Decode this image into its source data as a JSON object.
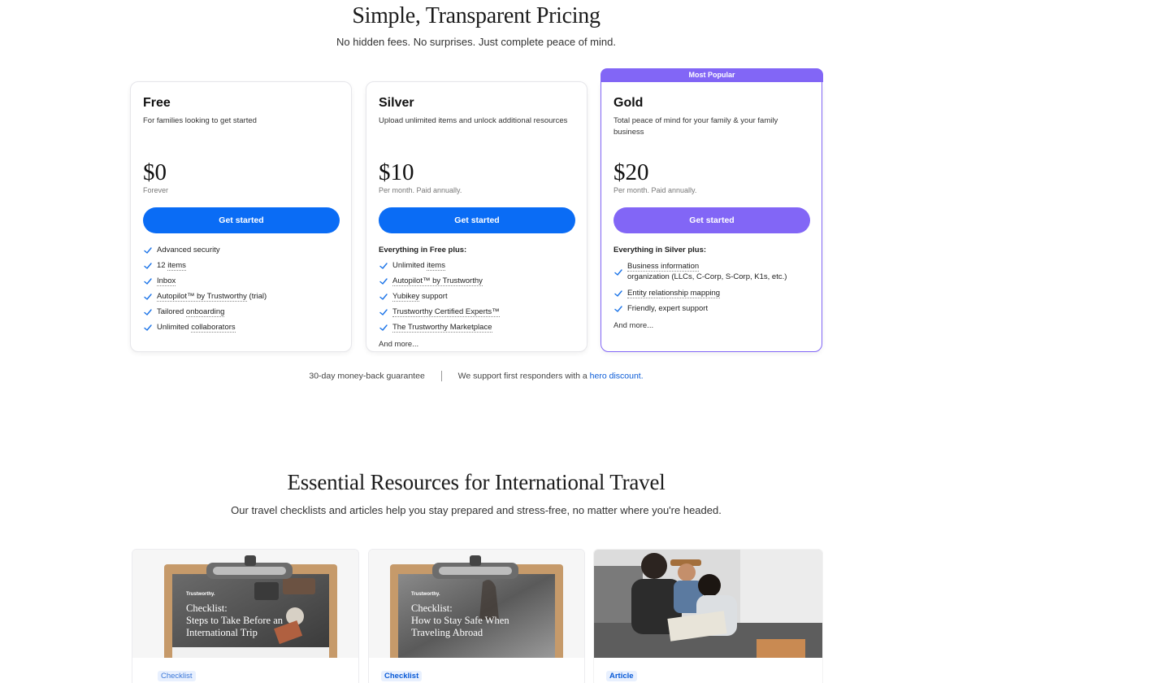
{
  "pricing": {
    "title": "Simple, Transparent Pricing",
    "subtitle": "No hidden fees. No surprises. Just complete peace of mind.",
    "popular_badge": "Most Popular",
    "plans": [
      {
        "name": "Free",
        "description": "For families looking to get started",
        "price": "$0",
        "price_note": "Forever",
        "button": "Get started",
        "features_heading": "",
        "features": [
          {
            "pre": "Advanced security",
            "link": "",
            "post": ""
          },
          {
            "pre": "12 ",
            "link": "items",
            "post": ""
          },
          {
            "pre": "",
            "link": "Inbox",
            "post": ""
          },
          {
            "pre": "",
            "link": "Autopilot™ by Trustworthy",
            "post": " (trial)"
          },
          {
            "pre": "Tailored ",
            "link": "onboarding",
            "post": ""
          },
          {
            "pre": "Unlimited ",
            "link": "collaborators",
            "post": ""
          }
        ],
        "more": ""
      },
      {
        "name": "Silver",
        "description": "Upload unlimited items and unlock additional resources",
        "price": "$10",
        "price_note": "Per month. Paid annually.",
        "button": "Get started",
        "features_heading": "Everything in Free plus:",
        "features": [
          {
            "pre": "Unlimited ",
            "link": "items",
            "post": ""
          },
          {
            "pre": "",
            "link": "Autopilot™ by Trustworthy",
            "post": ""
          },
          {
            "pre": "",
            "link": "Yubikey",
            "post": " support"
          },
          {
            "pre": "",
            "link": "Trustworthy Certified Experts™",
            "post": ""
          },
          {
            "pre": "",
            "link": "The Trustworthy Marketplace",
            "post": ""
          }
        ],
        "more": "And more..."
      },
      {
        "name": "Gold",
        "description": "Total peace of mind for your family & your family business",
        "price": "$20",
        "price_note": "Per month. Paid annually.",
        "button": "Get started",
        "features_heading": "Everything in Silver plus:",
        "features": [
          {
            "pre": "",
            "link": "Business information",
            "post": "organization (LLCs, C-Corp, S-Corp, K1s, etc.)"
          },
          {
            "pre": "",
            "link": "Entity relationship mapping",
            "post": ""
          },
          {
            "pre": "Friendly, expert support",
            "link": "",
            "post": ""
          }
        ],
        "more": "And more..."
      }
    ],
    "guarantee": "30-day money-back guarantee",
    "hero_text": "We support first responders with a ",
    "hero_link": "hero discount."
  },
  "resources": {
    "title": "Essential Resources for International Travel",
    "subtitle": "Our travel checklists and articles help you stay prepared and stress-free, no matter where you're headed.",
    "cards": [
      {
        "tag": "Checklist",
        "brand": "Trustworthy.",
        "heading_line1": "Checklist:",
        "heading_line2": "Steps to Take Before an",
        "heading_line3": "International Trip"
      },
      {
        "tag": "Checklist",
        "brand": "Trustworthy.",
        "heading_line1": "Checklist:",
        "heading_line2": "How to Stay Safe When",
        "heading_line3": "Traveling Abroad"
      },
      {
        "tag": "Article"
      }
    ]
  },
  "colors": {
    "primary_blue": "#0a6cf5",
    "gold_purple": "#8266f6",
    "link_blue": "#0a5bd7"
  }
}
